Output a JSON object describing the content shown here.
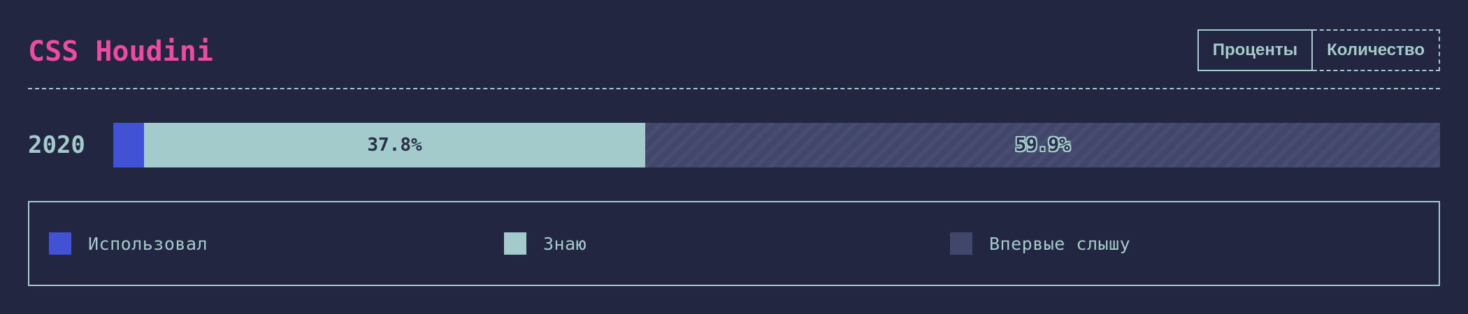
{
  "header": {
    "title": "CSS Houdini",
    "toggle": {
      "percent_label": "Проценты",
      "count_label": "Количество",
      "active": "percent"
    }
  },
  "colors": {
    "background": "#232640",
    "title": "#ef4aa1",
    "text": "#a3cbcb",
    "used": "#4153d4",
    "know": "#a3cbcb",
    "never_heard": "#41466b"
  },
  "chart_data": {
    "type": "bar",
    "orientation": "horizontal",
    "stacked": true,
    "title": "CSS Houdini",
    "categories": [
      "2020"
    ],
    "series": [
      {
        "name": "Использовал",
        "values": [
          2.3
        ],
        "color": "#4153d4",
        "data_label": ""
      },
      {
        "name": "Знаю",
        "values": [
          37.8
        ],
        "color": "#a3cbcb",
        "data_label": "37.8%"
      },
      {
        "name": "Впервые слышу",
        "values": [
          59.9
        ],
        "color": "#41466b",
        "data_label": "59.9%"
      }
    ],
    "xlim": [
      0,
      100
    ],
    "unit": "%",
    "legend_position": "bottom"
  },
  "legend": {
    "items": [
      {
        "label": "Использовал",
        "color": "#4153d4"
      },
      {
        "label": "Знаю",
        "color": "#a3cbcb"
      },
      {
        "label": "Впервые слышу",
        "color": "#41466b"
      }
    ]
  }
}
